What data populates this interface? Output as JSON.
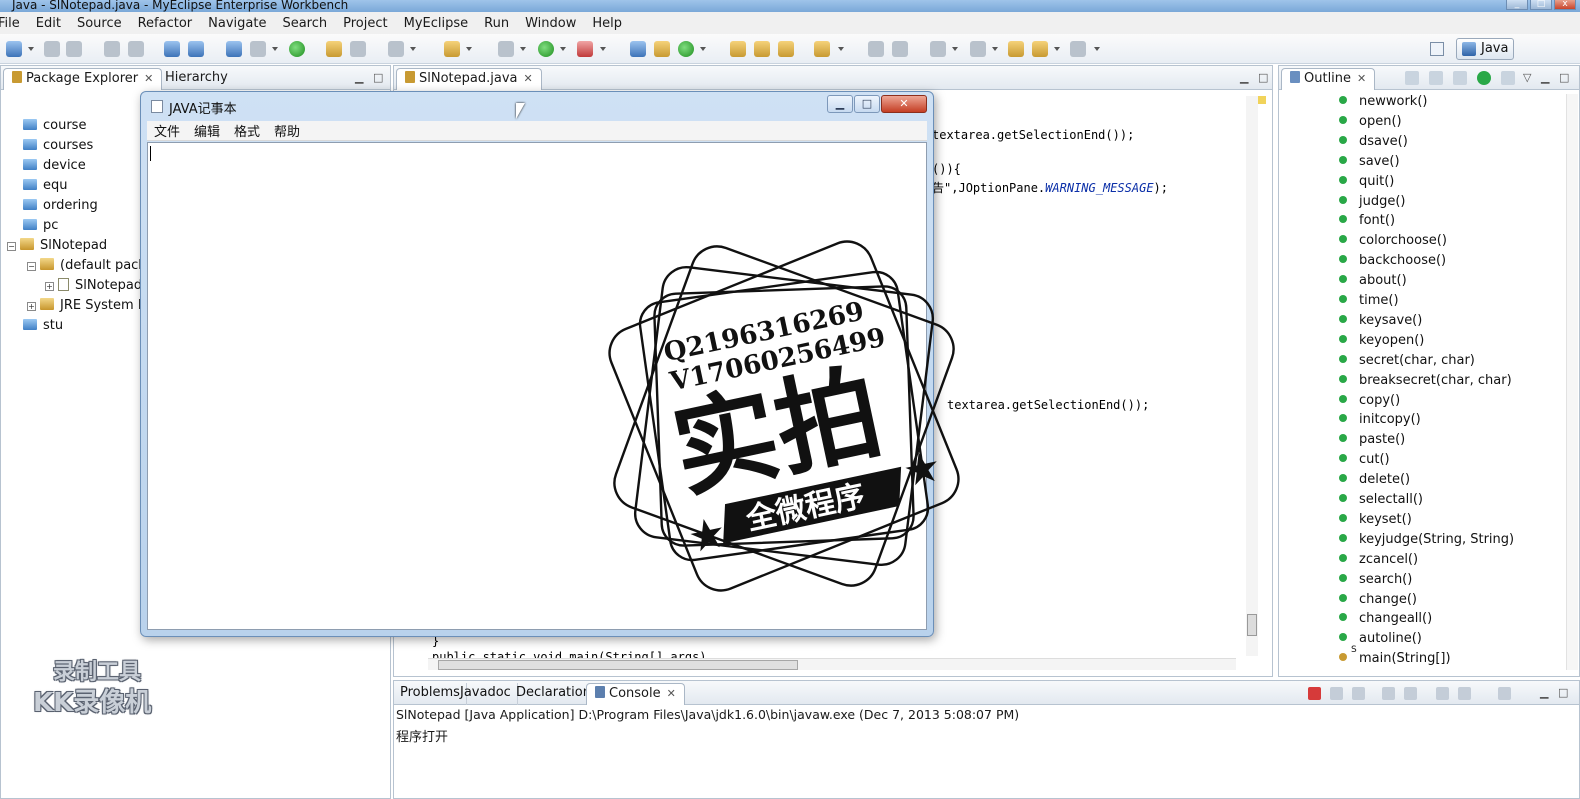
{
  "window": {
    "title": "Java - SlNotepad.java - MyEclipse Enterprise Workbench"
  },
  "menu": [
    "File",
    "Edit",
    "Source",
    "Refactor",
    "Navigate",
    "Search",
    "Project",
    "MyEclipse",
    "Run",
    "Window",
    "Help"
  ],
  "perspective": {
    "label": "Java"
  },
  "package_explorer": {
    "tabs": [
      "Package Explorer",
      "Hierarchy"
    ],
    "items": [
      "course",
      "courses",
      "device",
      "equ",
      "ordering",
      "pc",
      "SlNotepad",
      "(default packa",
      "SlNotepad",
      "JRE System Li",
      "stu"
    ]
  },
  "editor": {
    "tab": "SlNotepad.java",
    "line1": "textarea.getSelectionEnd());",
    "line2": "()){",
    "line3_cn": "告",
    "line3_rest": "\",JOptionPane.",
    "line3_italic": "WARNING_MESSAGE",
    "line3_end": ");",
    "line4": "textarea.getSelectionEnd());",
    "line5": "}",
    "line6": "public static void main(String[] args)"
  },
  "outline": {
    "tab": "Outline",
    "items": [
      "newwork()",
      "open()",
      "dsave()",
      "save()",
      "quit()",
      "judge()",
      "font()",
      "colorchoose()",
      "backchoose()",
      "about()",
      "time()",
      "keysave()",
      "keyopen()",
      "secret(char, char)",
      "breaksecret(char, char)",
      "copy()",
      "initcopy()",
      "paste()",
      "cut()",
      "delete()",
      "selectall()",
      "keyset()",
      "keyjudge(String, String)",
      "zcancel()",
      "search()",
      "change()",
      "changeall()",
      "autoline()",
      "main(String[])"
    ],
    "static_marker": "S"
  },
  "console": {
    "tabs": [
      "Problems",
      "Javadoc",
      "Declaration",
      "Console"
    ],
    "header": "SlNotepad [Java Application] D:\\Program Files\\Java\\jdk1.6.0\\bin\\javaw.exe (Dec 7, 2013 5:08:07 PM)",
    "output": "程序打开"
  },
  "notepad": {
    "title": "JAVA记事本",
    "menu": [
      "文件",
      "编辑",
      "格式",
      "帮助"
    ]
  },
  "stamp": {
    "line1": "Q2196316269",
    "line2": "V17060256499",
    "big": "实拍",
    "banner": "全微程序"
  },
  "recorder_watermark": {
    "line1": "录制工具",
    "line2": "KK录像机"
  },
  "colors": {
    "accent": "#2e63a8",
    "method_public": "#29a847",
    "stamp": "#111111"
  }
}
